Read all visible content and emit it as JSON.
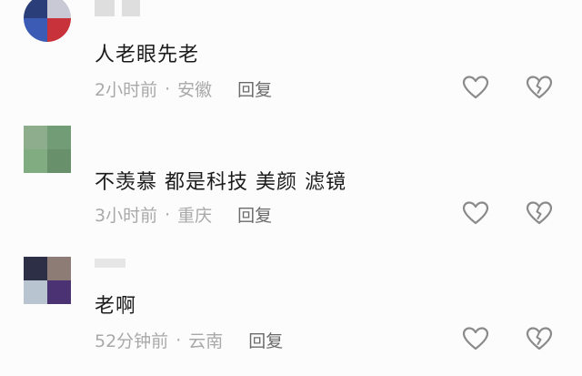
{
  "comments": [
    {
      "text": "人老眼先老",
      "time": "2小时前",
      "separator": "·",
      "location": "安徽",
      "reply_label": "回复",
      "avatar_colors": [
        "#2a3f7a",
        "#c9c9d6",
        "#3b5bb5",
        "#c8323a"
      ]
    },
    {
      "text": "不羡慕 都是科技 美颜 滤镜",
      "time": "3小时前",
      "separator": "·",
      "location": "重庆",
      "reply_label": "回复",
      "avatar_colors": [
        "#7aa07a",
        "#5a8c5e",
        "#6c9d6c",
        "#4f7f52"
      ]
    },
    {
      "text": "老啊",
      "time": "52分钟前",
      "separator": "·",
      "location": "云南",
      "reply_label": "回复",
      "avatar_colors": [
        "#2c2f45",
        "#8d7c76",
        "#b8c4cf",
        "#4b3272"
      ]
    }
  ],
  "icons": {
    "like": "heart-outline-icon",
    "dislike": "broken-heart-outline-icon",
    "color": "#8a8a8a"
  }
}
